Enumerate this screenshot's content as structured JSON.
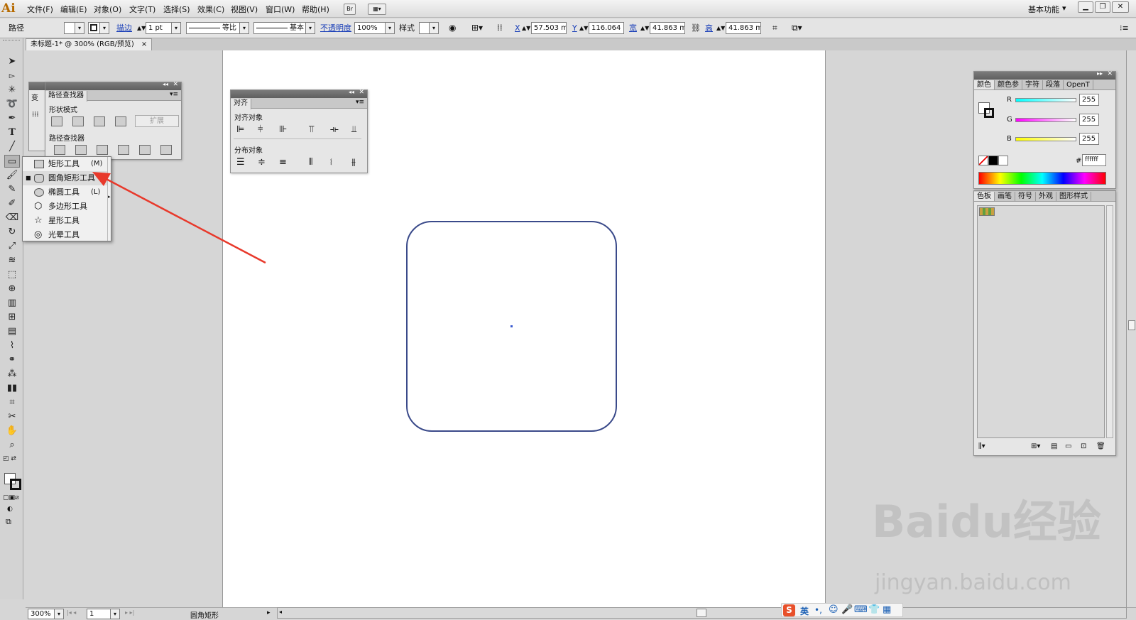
{
  "menubar": {
    "logo": "Ai",
    "items": [
      "文件(F)",
      "编辑(E)",
      "对象(O)",
      "文字(T)",
      "选择(S)",
      "效果(C)",
      "视图(V)",
      "窗口(W)",
      "帮助(H)"
    ],
    "bridge_label": "Br",
    "workspace": "基本功能"
  },
  "control": {
    "object_type": "路径",
    "stroke_label": "描边",
    "stroke_weight": "1 pt",
    "profile": "等比",
    "brush": "基本",
    "opacity_label": "不透明度",
    "opacity": "100%",
    "style_label": "样式",
    "x_label": "X",
    "x": "57.503 m",
    "y_label": "Y",
    "y": "116.064 r",
    "w_label": "宽",
    "w": "41.863 m",
    "h_label": "高",
    "h": "41.863 m"
  },
  "document": {
    "tab": "未标题-1* @ 300% (RGB/预览)",
    "shape": "rounded-rectangle",
    "stroke_color": "#3a4a8a"
  },
  "pathfinder": {
    "tab_short": "变",
    "title": "路径查找器",
    "shape_modes": "形状模式",
    "expand": "扩展",
    "pathfinders": "路径查找器"
  },
  "align": {
    "title": "对齐",
    "align_objects": "对齐对象",
    "distribute_objects": "分布对象"
  },
  "flyout": {
    "items": [
      {
        "label": "矩形工具",
        "shortcut": "(M)",
        "icon": "rectangle-icon"
      },
      {
        "label": "圆角矩形工具",
        "shortcut": "",
        "icon": "rounded-rectangle-icon"
      },
      {
        "label": "椭圆工具",
        "shortcut": "(L)",
        "icon": "ellipse-icon"
      },
      {
        "label": "多边形工具",
        "shortcut": "",
        "icon": "polygon-icon"
      },
      {
        "label": "星形工具",
        "shortcut": "",
        "icon": "star-icon"
      },
      {
        "label": "光晕工具",
        "shortcut": "",
        "icon": "flare-icon"
      }
    ]
  },
  "color_panel": {
    "tabs": [
      "颜色",
      "颜色参",
      "字符",
      "段落",
      "OpenT"
    ],
    "r_label": "R",
    "r": "255",
    "g_label": "G",
    "g": "255",
    "b_label": "B",
    "b": "255",
    "hex_label": "#",
    "hex": "ffffff"
  },
  "swatch_panel": {
    "tabs": [
      "色板",
      "画笔",
      "符号",
      "外观",
      "图形样式"
    ]
  },
  "status": {
    "zoom": "300%",
    "page": "1",
    "tool": "圆角矩形"
  },
  "watermark": {
    "brand": "Baidu经验",
    "url": "jingyan.baidu.com"
  },
  "ime": {
    "logo": "S",
    "lang": "英"
  },
  "annotation": {
    "arrow_color": "#e8392b"
  }
}
